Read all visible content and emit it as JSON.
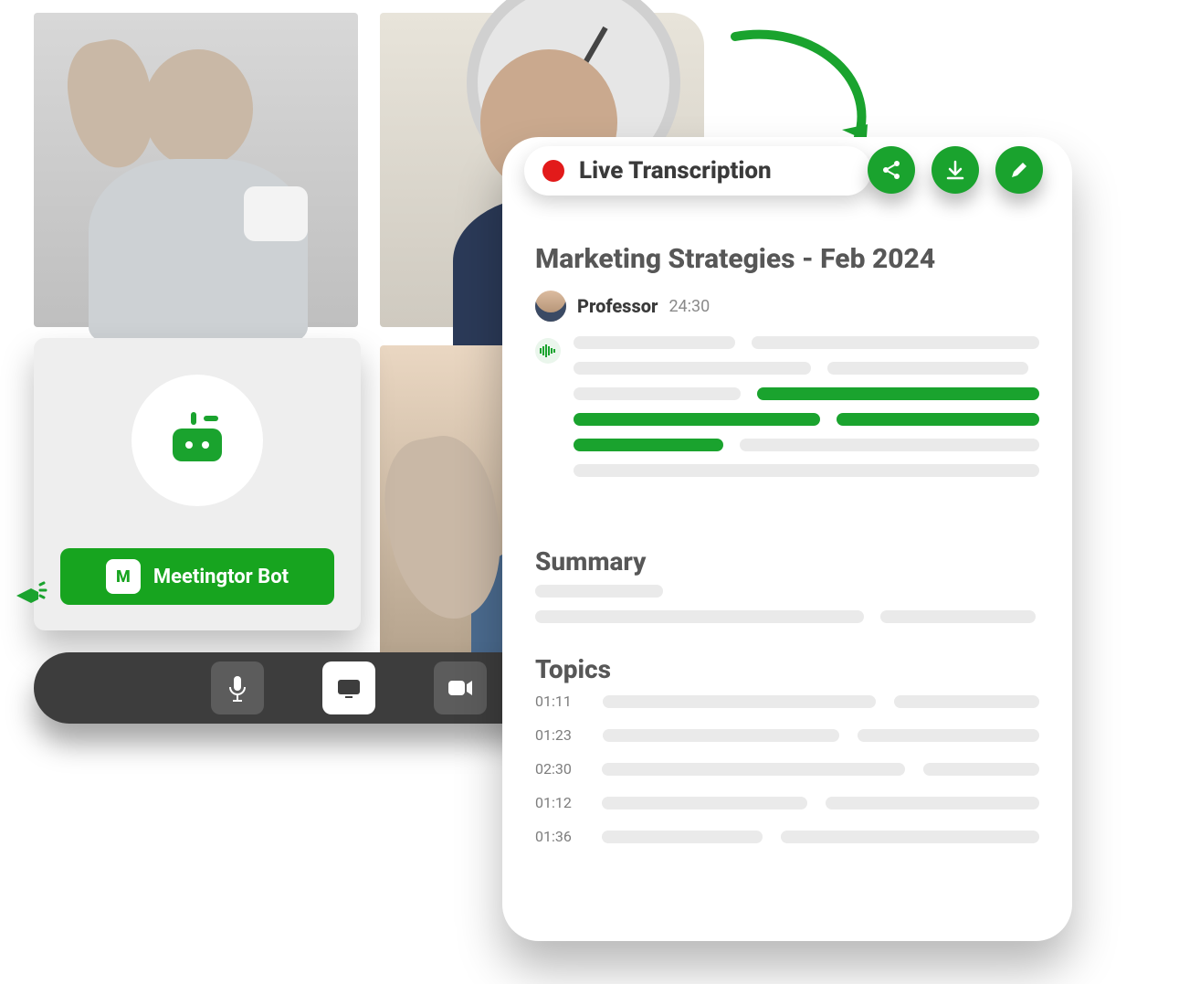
{
  "colors": {
    "accent": "#1aa32e",
    "record": "#e21a1a"
  },
  "bot": {
    "label": "Meetingtor Bot",
    "badge_letter": "M"
  },
  "pill": {
    "label": "Live Transcription"
  },
  "actions": {
    "share": "share",
    "download": "download",
    "edit": "edit"
  },
  "transcript": {
    "title": "Marketing Strategies - Feb 2024",
    "speaker": "Professor",
    "time": "24:30",
    "summary_label": "Summary",
    "topics_label": "Topics",
    "topics": [
      {
        "time": "01:11"
      },
      {
        "time": "01:23"
      },
      {
        "time": "02:30"
      },
      {
        "time": "01:12"
      },
      {
        "time": "01:36"
      }
    ]
  }
}
